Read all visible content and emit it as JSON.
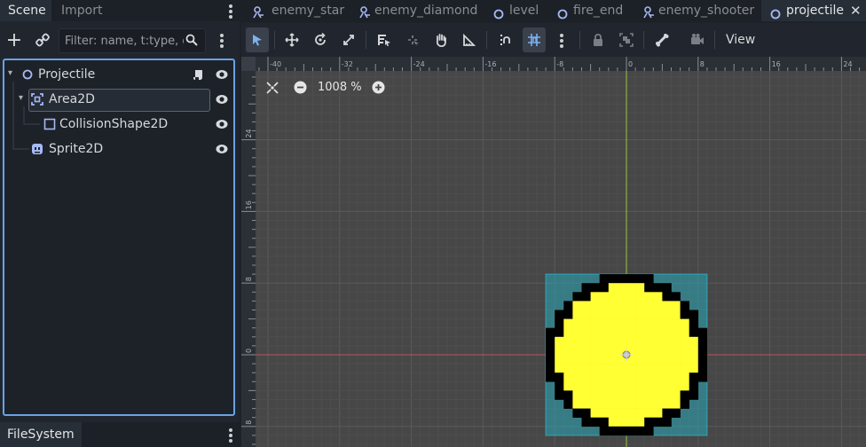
{
  "left_dock": {
    "tabs": [
      "Scene",
      "Import"
    ],
    "filter_placeholder": "Filter: name, t:type, g:group",
    "tree": [
      {
        "label": "Projectile",
        "icon": "node2d-circle-icon"
      },
      {
        "label": "Area2D",
        "icon": "area2d-icon"
      },
      {
        "label": "CollisionShape2D",
        "icon": "collisionshape2d-icon"
      },
      {
        "label": "Sprite2D",
        "icon": "sprite2d-icon"
      }
    ],
    "bottom_tab": "FileSystem"
  },
  "scene_tabs": [
    {
      "label": "enemy_star",
      "icon": "scene-character-icon"
    },
    {
      "label": "enemy_diamond",
      "icon": "scene-character-icon"
    },
    {
      "label": "level",
      "icon": "scene-node-icon"
    },
    {
      "label": "fire_end",
      "icon": "scene-node-icon"
    },
    {
      "label": "enemy_shooter",
      "icon": "scene-character-icon"
    },
    {
      "label": "projectile",
      "icon": "scene-node-icon",
      "active": true
    }
  ],
  "editor_toolbar": {
    "view_label": "View"
  },
  "viewport": {
    "zoom": "1008 %",
    "ruler_top_labels": [
      "-40",
      "-32",
      "-24",
      "-16",
      "-8",
      "0",
      "8",
      "16",
      "24"
    ],
    "ruler_left_labels": [
      "24",
      "16",
      "8",
      "0",
      "8"
    ],
    "colors": {
      "background": "#474747",
      "sprite_fill": "#ffff33",
      "sprite_outline": "#000000",
      "collision_shape": "#2aa8b8",
      "x_axis": "#c0505f",
      "y_axis": "#93c93b",
      "selection_accent": "#6aa2e6"
    }
  }
}
